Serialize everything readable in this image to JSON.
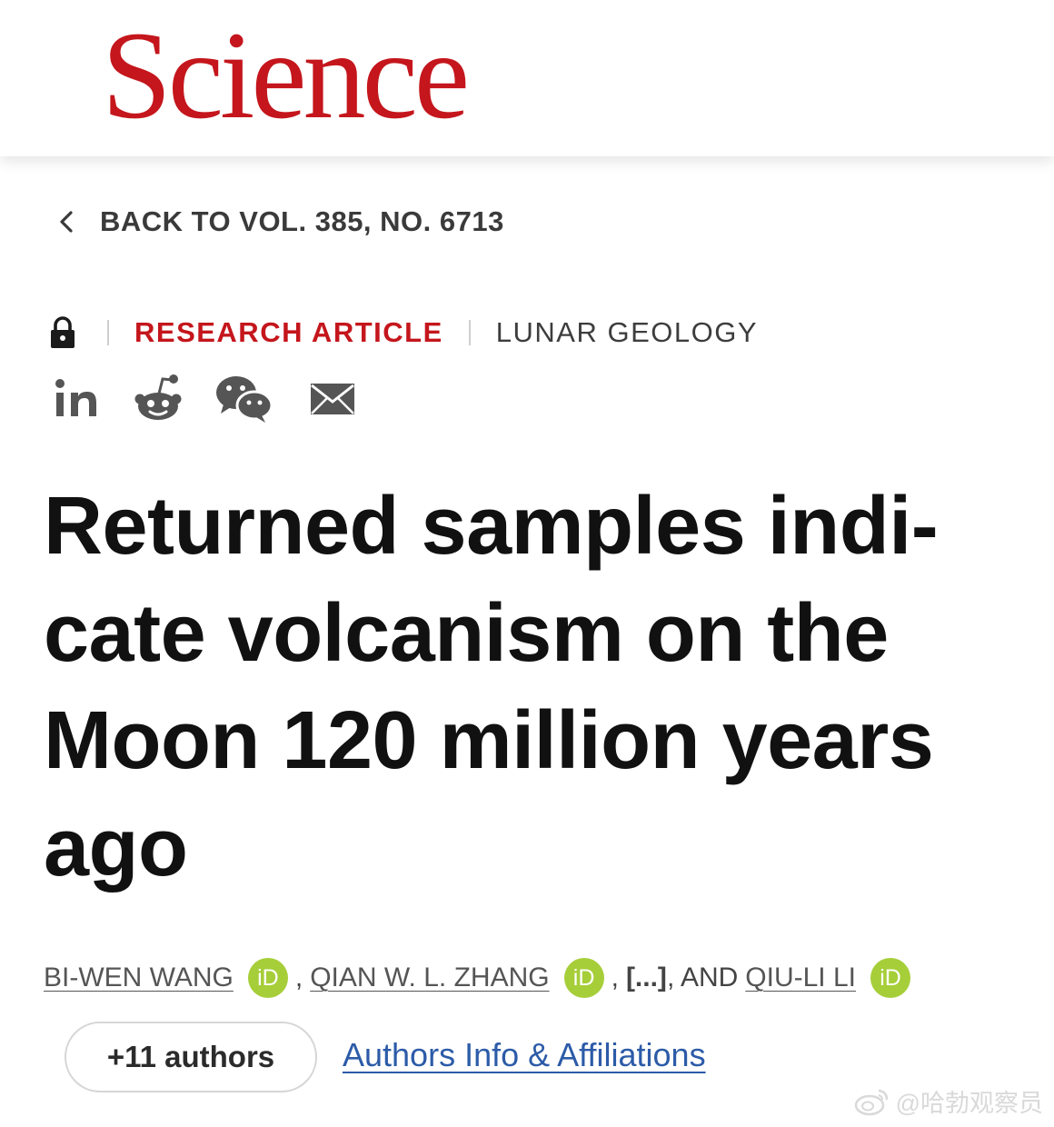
{
  "header": {
    "logo_text": "Science",
    "logo_color": "#c4161c"
  },
  "navigation": {
    "back_label": "BACK TO VOL. 385, NO. 6713",
    "back_icon": "chevron-left-icon"
  },
  "article_meta": {
    "access_icon": "lock-icon",
    "type": "RESEARCH ARTICLE",
    "subject": "LUNAR GEOLOGY"
  },
  "share": {
    "icons": [
      "linkedin-icon",
      "reddit-icon",
      "wechat-icon",
      "email-icon"
    ]
  },
  "article": {
    "title": "Returned samples indi-cate volcanism on the Moon 120 million years ago"
  },
  "authors": {
    "author_1": "BI-WEN WANG",
    "separator_1": ",",
    "author_2": "QIAN W. L. ZHANG",
    "separator_2": ",",
    "ellipsis": "[...]",
    "and_text": ", AND",
    "author_3": "QIU-LI LI",
    "orcid_label": "iD",
    "orcid_color": "#a6ce39",
    "more_button": "+11 authors",
    "affiliations_link": "Authors Info & Affiliations",
    "link_color": "#2c5ba8"
  },
  "watermark": {
    "text": "@哈勃观察员"
  }
}
